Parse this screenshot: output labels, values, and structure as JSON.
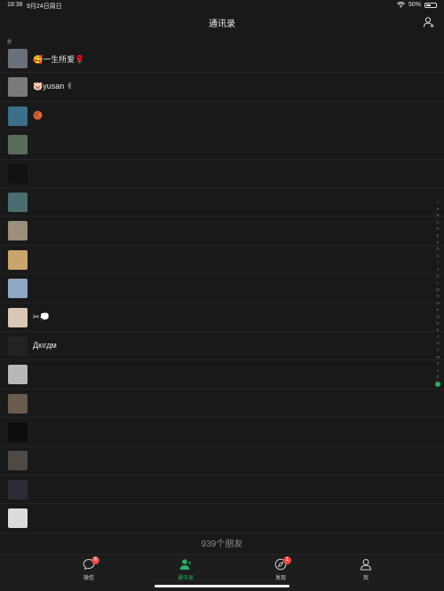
{
  "status_bar": {
    "time": "18:38",
    "date": "9月24日周日",
    "battery": "50%"
  },
  "nav": {
    "title": "通讯录"
  },
  "section_header": "#",
  "contacts": [
    {
      "name": "🥰一生所爱🌹",
      "avatar_color": "#6b6f7a"
    },
    {
      "name": "🐷yusan ✌",
      "avatar_color": "#7a7a7a"
    },
    {
      "name": "🏀",
      "avatar_color": "#3b6f8a"
    },
    {
      "name": "",
      "avatar_color": "#5a6d5a"
    },
    {
      "name": "",
      "avatar_color": "#111111"
    },
    {
      "name": "",
      "avatar_color": "#4a6e6f"
    },
    {
      "name": "",
      "avatar_color": "#9a8f7a"
    },
    {
      "name": "",
      "avatar_color": "#c9a56d"
    },
    {
      "name": "",
      "avatar_color": "#8fa8c4"
    },
    {
      "name": "✂💭",
      "avatar_color": "#d9c8b6"
    },
    {
      "name": "Дкıгдм",
      "avatar_color": "#222222"
    },
    {
      "name": "",
      "avatar_color": "#b8b8b8"
    },
    {
      "name": "",
      "avatar_color": "#6a5b4d"
    },
    {
      "name": "",
      "avatar_color": "#0d0d0d"
    },
    {
      "name": "",
      "avatar_color": "#4d4a45"
    },
    {
      "name": "",
      "avatar_color": "#2b2c35"
    },
    {
      "name": "",
      "avatar_color": "#dcdcdc"
    }
  ],
  "index_letters": [
    "☆",
    "A",
    "B",
    "C",
    "D",
    "E",
    "F",
    "G",
    "H",
    "I",
    "J",
    "K",
    "L",
    "M",
    "N",
    "O",
    "P",
    "Q",
    "R",
    "S",
    "T",
    "U",
    "V",
    "W",
    "X",
    "Y",
    "Z"
  ],
  "friend_count": "939个朋友",
  "tabs": [
    {
      "label": "微信",
      "icon": "chat-icon",
      "badge": "6"
    },
    {
      "label": "通讯录",
      "icon": "contacts-icon",
      "badge": ""
    },
    {
      "label": "发现",
      "icon": "compass-icon",
      "badge": "1"
    },
    {
      "label": "我",
      "icon": "person-icon",
      "badge": ""
    }
  ],
  "accent_color": "#2aae67"
}
